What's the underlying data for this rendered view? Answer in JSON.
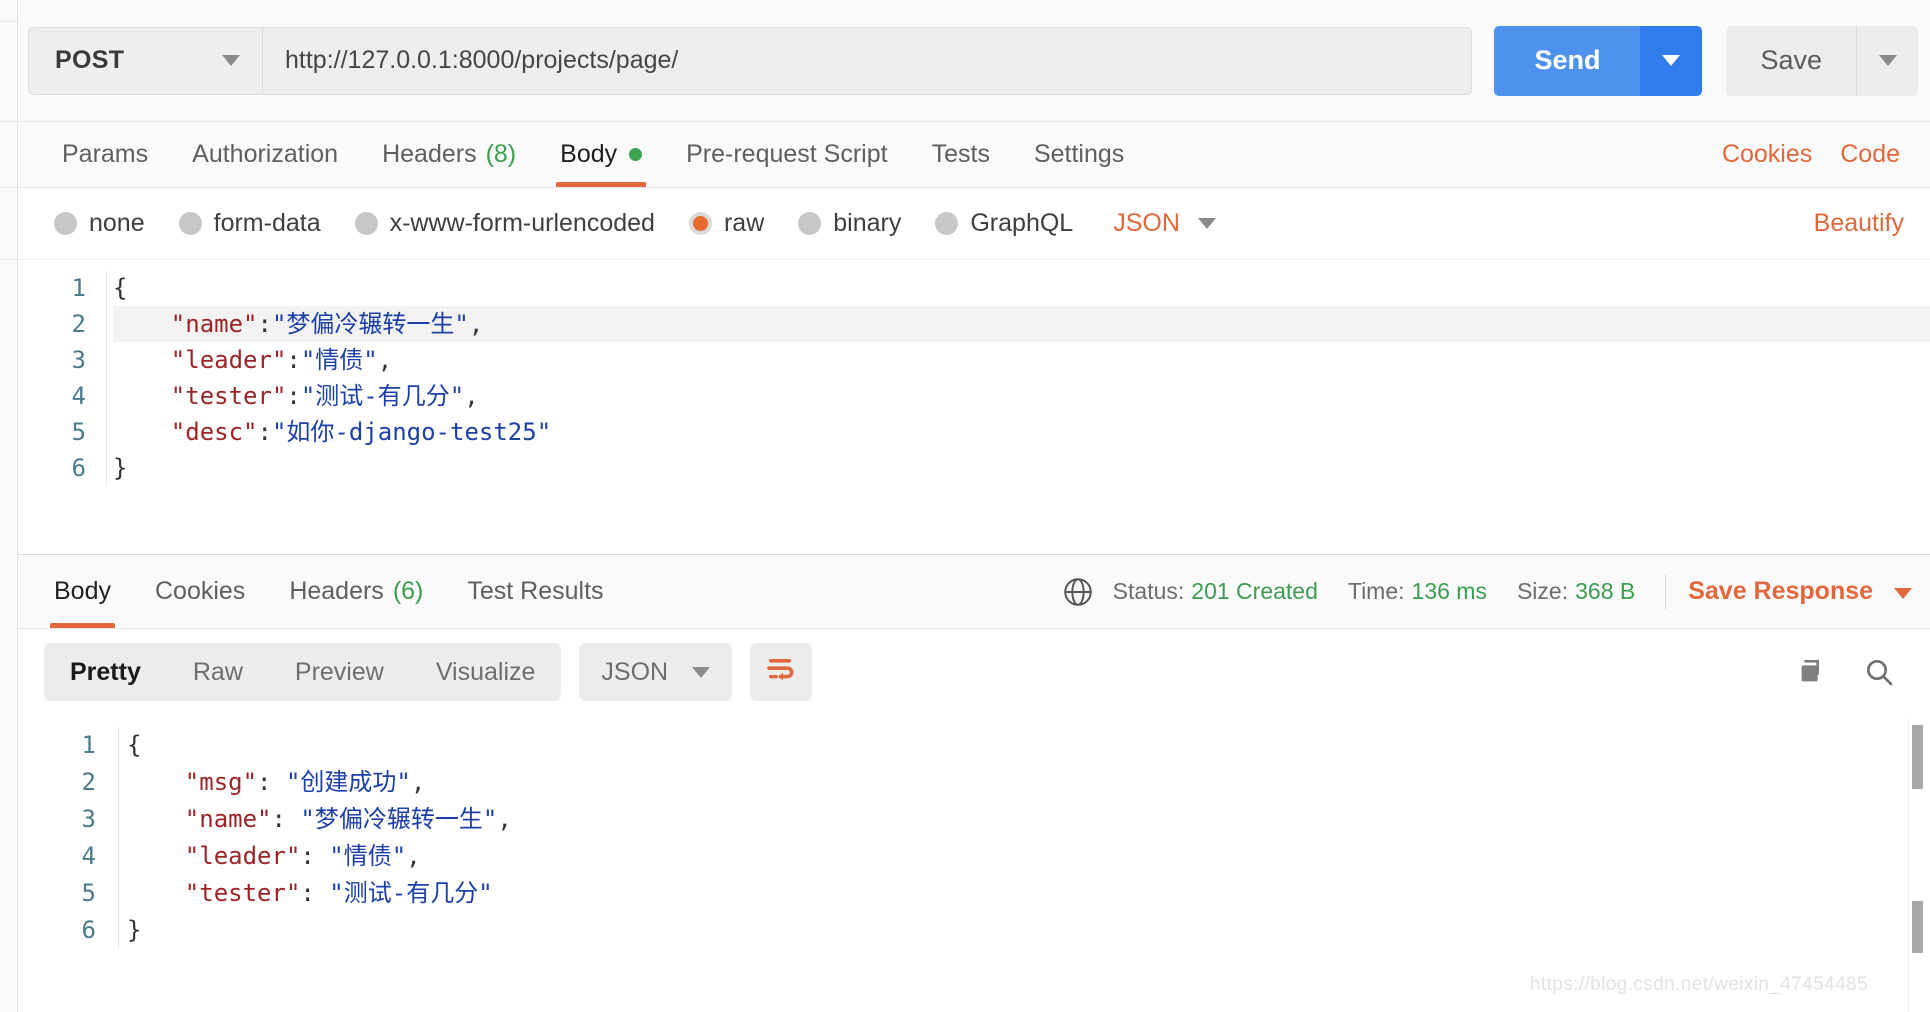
{
  "request": {
    "method": "POST",
    "url": "http://127.0.0.1:8000/projects/page/",
    "send_label": "Send",
    "save_label": "Save",
    "tabs": [
      {
        "label": "Params",
        "count": "",
        "active": false
      },
      {
        "label": "Authorization",
        "count": "",
        "active": false
      },
      {
        "label": "Headers",
        "count": "(8)",
        "active": false
      },
      {
        "label": "Body",
        "count": "",
        "active": true
      },
      {
        "label": "Pre-request Script",
        "count": "",
        "active": false
      },
      {
        "label": "Tests",
        "count": "",
        "active": false
      },
      {
        "label": "Settings",
        "count": "",
        "active": false
      }
    ],
    "right_links": [
      {
        "label": "Cookies"
      },
      {
        "label": "Code"
      }
    ],
    "body_types": [
      {
        "label": "none",
        "selected": false
      },
      {
        "label": "form-data",
        "selected": false
      },
      {
        "label": "x-www-form-urlencoded",
        "selected": false
      },
      {
        "label": "raw",
        "selected": true
      },
      {
        "label": "binary",
        "selected": false
      },
      {
        "label": "GraphQL",
        "selected": false
      }
    ],
    "format_label": "JSON",
    "beautify_label": "Beautify",
    "body_lines": [
      {
        "num": "1",
        "indent": 0,
        "key": "",
        "value": "",
        "punct": "{",
        "highlight": false
      },
      {
        "num": "2",
        "indent": 1,
        "key": "\"name\"",
        "sep": ":",
        "value": "\"梦偏冷辗转一生\"",
        "punct": ",",
        "highlight": true
      },
      {
        "num": "3",
        "indent": 1,
        "key": "\"leader\"",
        "sep": ":",
        "value": "\"情债\"",
        "punct": ",",
        "highlight": false
      },
      {
        "num": "4",
        "indent": 1,
        "key": "\"tester\"",
        "sep": ":",
        "value": "\"测试-有几分\"",
        "punct": ",",
        "highlight": false
      },
      {
        "num": "5",
        "indent": 1,
        "key": "\"desc\"",
        "sep": ":",
        "value": "\"如你-django-test25\"",
        "punct": "",
        "highlight": false
      },
      {
        "num": "6",
        "indent": 0,
        "key": "",
        "value": "",
        "punct": "}",
        "highlight": false
      }
    ]
  },
  "response": {
    "tabs": [
      {
        "label": "Body",
        "count": "",
        "active": true
      },
      {
        "label": "Cookies",
        "count": "",
        "active": false
      },
      {
        "label": "Headers",
        "count": "(6)",
        "active": false
      },
      {
        "label": "Test Results",
        "count": "",
        "active": false
      }
    ],
    "status_label": "Status:",
    "status_value": "201 Created",
    "time_label": "Time:",
    "time_value": "136 ms",
    "size_label": "Size:",
    "size_value": "368 B",
    "save_response_label": "Save Response",
    "view_modes": [
      {
        "label": "Pretty",
        "active": true
      },
      {
        "label": "Raw",
        "active": false
      },
      {
        "label": "Preview",
        "active": false
      },
      {
        "label": "Visualize",
        "active": false
      }
    ],
    "format_label": "JSON",
    "body_lines": [
      {
        "num": "1",
        "indent": 0,
        "key": "",
        "value": "",
        "punct": "{"
      },
      {
        "num": "2",
        "indent": 1,
        "key": "\"msg\"",
        "sep": ": ",
        "value": "\"创建成功\"",
        "punct": ","
      },
      {
        "num": "3",
        "indent": 1,
        "key": "\"name\"",
        "sep": ": ",
        "value": "\"梦偏冷辗转一生\"",
        "punct": ","
      },
      {
        "num": "4",
        "indent": 1,
        "key": "\"leader\"",
        "sep": ": ",
        "value": "\"情债\"",
        "punct": ","
      },
      {
        "num": "5",
        "indent": 1,
        "key": "\"tester\"",
        "sep": ": ",
        "value": "\"测试-有几分\"",
        "punct": ""
      },
      {
        "num": "6",
        "indent": 0,
        "key": "",
        "value": "",
        "punct": "}"
      }
    ]
  },
  "watermark": "https://blog.csdn.net/weixin_47454485",
  "colors": {
    "accent_orange": "#e0683c",
    "send_blue": "#4e92f0",
    "send_blue_dark": "#2f7ded",
    "status_green": "#3b9e4f",
    "json_key": "#9c2426",
    "json_value": "#1d3fa8"
  }
}
